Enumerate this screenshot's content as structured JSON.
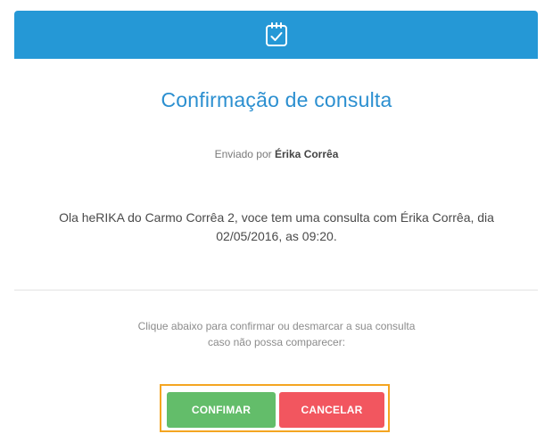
{
  "header": {
    "icon": "calendar-check-icon",
    "background_color": "#2598d6"
  },
  "title": "Confirmação de consulta",
  "sender": {
    "prefix": "Enviado por",
    "name": "Érika Corrêa"
  },
  "message": {
    "line1": "Ola heRIKA do Carmo Corrêa 2, voce tem uma consulta com Érika Corrêa, dia",
    "line2": "02/05/2016, as 09:20."
  },
  "instructions": {
    "line1": "Clique abaixo para confirmar ou desmarcar a sua consulta",
    "line2": "caso não possa comparecer:"
  },
  "buttons": {
    "confirm_label": "CONFIMAR",
    "confirm_color": "#63bd6a",
    "cancel_label": "CANCELAR",
    "cancel_color": "#f2565f",
    "highlight_color": "#f4a521"
  }
}
